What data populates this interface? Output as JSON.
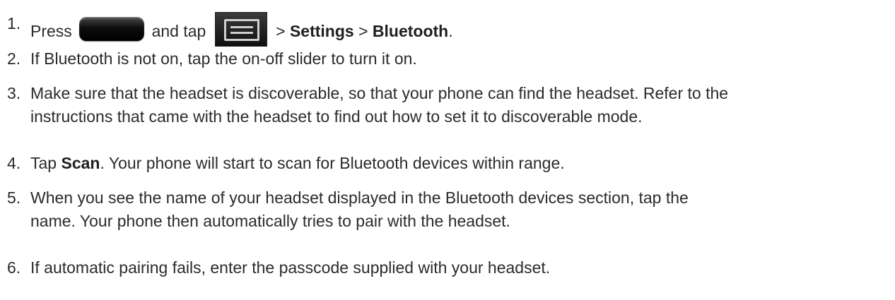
{
  "steps": [
    {
      "number": "1.",
      "press": "Press",
      "and_tap": "and tap",
      "sep1": ">",
      "settings": "Settings",
      "sep2": ">",
      "bluetooth": "Bluetooth",
      "period": ".",
      "icons": [
        "home-key-icon",
        "menu-key-icon"
      ]
    },
    {
      "number": "2.",
      "text": "If Bluetooth is not on, tap the on-off slider to turn it on."
    },
    {
      "number": "3.",
      "line1": "Make sure that the headset is discoverable, so that your phone can find the headset. Refer to the",
      "line2": "instructions that came with the headset to find out how to set it to discoverable mode."
    },
    {
      "number": "4.",
      "tap": "Tap",
      "scan": "Scan",
      "rest": ". Your phone will start to scan for Bluetooth devices within range."
    },
    {
      "number": "5.",
      "line1": "When you see the name of your headset displayed in the Bluetooth devices section, tap the",
      "line2": "name. Your phone then automatically tries to pair with the headset."
    },
    {
      "number": "6.",
      "text": "If automatic pairing fails, enter the passcode supplied with your headset."
    }
  ]
}
